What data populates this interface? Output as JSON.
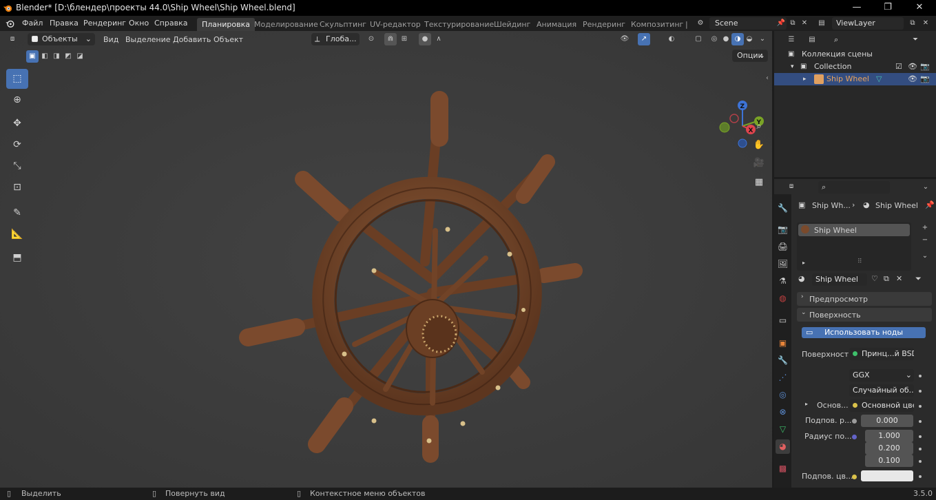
{
  "window": {
    "title": "Blender* [D:\\блендер\\проекты 44.0\\Ship Wheel\\Ship Wheel.blend]",
    "minimize": "—",
    "maximize": "❐",
    "close": "✕"
  },
  "menu": {
    "items": [
      "Файл",
      "Правка",
      "Рендеринг",
      "Окно",
      "Справка"
    ]
  },
  "workspaces": {
    "tabs": [
      "Планировка",
      "Моделирование",
      "Скульптинг",
      "UV-редактор",
      "Текстурирование",
      "Шейдинг",
      "Анимация",
      "Рендеринг",
      "Композитинг"
    ],
    "active": "Планировка",
    "overflow": "|"
  },
  "scene": {
    "name": "Scene"
  },
  "viewlayer": {
    "name": "ViewLayer"
  },
  "viewport": {
    "mode": "Объекты",
    "header_menus": [
      "Вид",
      "Выделение",
      "Добавить",
      "Объект"
    ],
    "transform_orientation": "Глоба...",
    "options_label": "Опции",
    "gizmo": {
      "x": "X",
      "y": "Y",
      "z": "Z"
    }
  },
  "outliner": {
    "search_placeholder": "",
    "scene_collection": "Коллекция сцены",
    "collection": "Collection",
    "object": "Ship Wheel"
  },
  "properties": {
    "breadcrumb_object": "Ship Wh...",
    "breadcrumb_material": "Ship Wheel",
    "slot_name": "Ship Wheel",
    "material_name": "Ship Wheel",
    "panel_preview": "Предпросмотр",
    "panel_surface": "Поверхность",
    "use_nodes_button": "Использовать ноды",
    "surface_label": "Поверхность",
    "surface_value": "Принц...й BSDF",
    "distribution": "GGX",
    "subsurface_method": "Случайный об...",
    "base_label": "Основ...",
    "base_value": "Основной цвет",
    "subsurface_label": "Подпов. р...",
    "subsurface_value": "0.000",
    "radius_label": "Радиус по...",
    "radius_values": [
      "1.000",
      "0.200",
      "0.100"
    ],
    "subsurface_color_label": "Подпов. цв..."
  },
  "statusbar": {
    "select": "Выделить",
    "rotate": "Повернуть вид",
    "context": "Контекстное меню объектов",
    "version": "3.5.0"
  },
  "colors": {
    "accent": "#4772b3",
    "viewport_bg": "#3d3d3d",
    "wood": "#7a4a2c",
    "selected_row": "#334d80",
    "object_text": "#e8a25c"
  }
}
